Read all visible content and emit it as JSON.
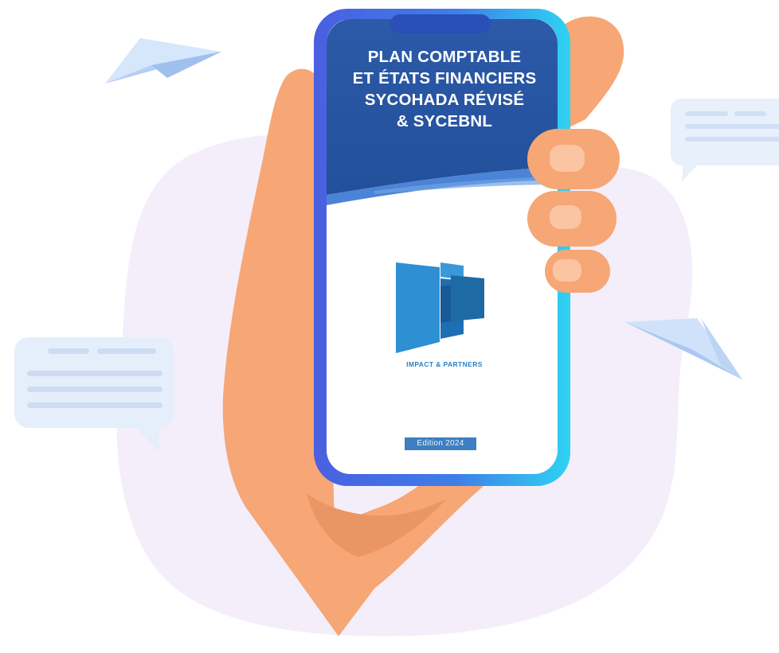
{
  "phone": {
    "title_lines": [
      "PLAN COMPTABLE",
      "ET ÉTATS FINANCIERS",
      "SYCOHADA RÉVISÉ",
      "& SYCEBNL"
    ],
    "brand": "IMPACT & PARTNERS",
    "edition": "Edition  2024"
  },
  "colors": {
    "phone_frame": "#3d6fe0",
    "screen_header": "#2b59a6",
    "skin": "#f7a676",
    "blob": "#f3eefa",
    "bubble": "#e5effb",
    "plane": "#cde0f8"
  }
}
